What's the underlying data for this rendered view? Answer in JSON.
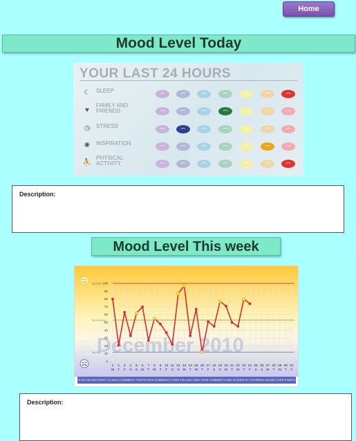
{
  "nav": {
    "home_label": "Home"
  },
  "today": {
    "heading": "Mood Level Today",
    "card_title": "YOUR LAST 24 HOURS",
    "rows": [
      {
        "label": "SLEEP",
        "icon": "sleep-icon",
        "selected_index": 6
      },
      {
        "label": "FAMILY AND FRIENDS",
        "icon": "heart-icon",
        "selected_index": 3
      },
      {
        "label": "STRESS",
        "icon": "clock-icon",
        "selected_index": 1
      },
      {
        "label": "INSPIRATION",
        "icon": "bulb-icon",
        "selected_index": 5
      },
      {
        "label": "PHYSICAL ACTIVITY",
        "icon": "runner-icon",
        "selected_index": 6
      }
    ],
    "palette_light": [
      "#c8b4d8",
      "#b3b8d6",
      "#a9d3e5",
      "#a8d4bd",
      "#f3f0a7",
      "#f1d4a8",
      "#f0aab0"
    ],
    "palette_selected": [
      "#8b57b0",
      "#2e3f92",
      "#3aa1cf",
      "#267a3d",
      "#e3d600",
      "#f1a21d",
      "#e0332c"
    ],
    "description_label": "Description:"
  },
  "week": {
    "heading": "Mood Level This week",
    "description_label": "Description:",
    "footer": "CLICK ON ANY POINT TO ADD A COMMENT. POINTS WITH COMMENTS TURN YELLOW. VIEW YOUR COMMENTS AND SCORES BY HOVERING MOUSE OVER POINTS."
  },
  "chart_data": {
    "type": "line",
    "watermark": "December 2010",
    "ylim": [
      0,
      100
    ],
    "yticks": [
      0,
      10,
      20,
      30,
      40,
      50,
      60,
      70,
      80,
      90,
      100
    ],
    "x": [
      1,
      2,
      3,
      4,
      5,
      6,
      7,
      8,
      9,
      10,
      11,
      12,
      13,
      14,
      15,
      16,
      17,
      18,
      19,
      20,
      21,
      22,
      23,
      24,
      25,
      26,
      27,
      28,
      29,
      30,
      31
    ],
    "weekdays": [
      "W",
      "T",
      "F",
      "S",
      "S",
      "M",
      "T",
      "W",
      "T",
      "F",
      "S",
      "S",
      "M",
      "T",
      "W",
      "T",
      "F",
      "S",
      "S",
      "M",
      "T",
      "W",
      "T",
      "F",
      "S",
      "S",
      "M",
      "T",
      "W",
      "T",
      "F"
    ],
    "values": [
      80,
      21,
      63,
      33,
      62,
      70,
      27,
      55,
      48,
      37,
      22,
      87,
      97,
      33,
      67,
      12,
      51,
      45,
      77,
      71,
      50,
      45,
      80,
      74
    ],
    "commented_days": [
      5,
      8,
      12,
      13,
      16,
      19,
      23
    ],
    "reference_lines": [
      {
        "label": "My Max",
        "value": 100,
        "color": "#d9443e"
      },
      {
        "label": "My Average",
        "value": 53,
        "color": "#9aa43a"
      },
      {
        "label": "My Min",
        "value": 12,
        "color": "#5a86c9"
      }
    ],
    "series_color": "#d22d32",
    "highlight_color": "#f2ea3a",
    "icons": [
      "smile-icon",
      "frown-icon"
    ]
  }
}
